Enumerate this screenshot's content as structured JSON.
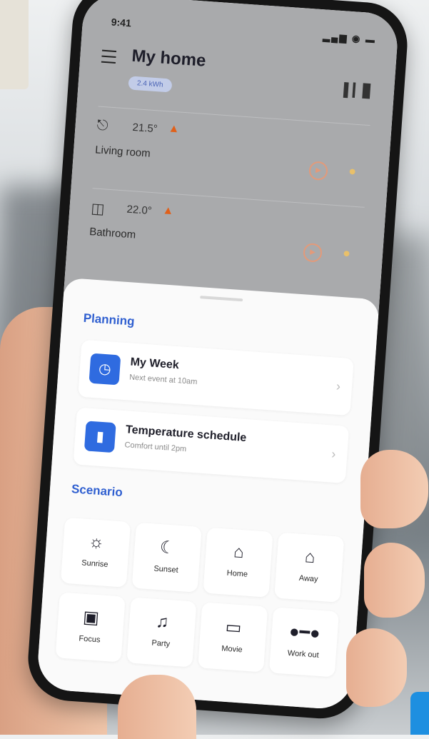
{
  "status_bar": {
    "time": "9:41",
    "indicators": "▂▄▆ ◉ ▬"
  },
  "header": {
    "title": "My home",
    "badge": "2.4 kWh"
  },
  "rooms": [
    {
      "name": "Living room",
      "temperature": "21.5°",
      "icon": "sofa-icon"
    },
    {
      "name": "Bathroom",
      "temperature": "22.0°",
      "icon": "bathtub-icon"
    }
  ],
  "planning": {
    "title": "Planning",
    "items": [
      {
        "title": "My Week",
        "subtitle": "Next event at 10am",
        "icon": "clock-icon"
      },
      {
        "title": "Temperature schedule",
        "subtitle": "Comfort until 2pm",
        "icon": "thermometer-icon"
      }
    ]
  },
  "scenario": {
    "title": "Scenario",
    "items": [
      {
        "label": "Sunrise",
        "icon": "sun-icon"
      },
      {
        "label": "Sunset",
        "icon": "moon-icon"
      },
      {
        "label": "Home",
        "icon": "home-arrive-icon"
      },
      {
        "label": "Away",
        "icon": "home-leave-icon"
      },
      {
        "label": "Focus",
        "icon": "briefcase-icon"
      },
      {
        "label": "Party",
        "icon": "party-icon"
      },
      {
        "label": "Movie",
        "icon": "monitor-icon"
      },
      {
        "label": "Work out",
        "icon": "dumbbell-icon"
      }
    ]
  },
  "colors": {
    "accent": "#2f6be0",
    "section_title": "#2f5fd0",
    "flame": "#e0601a"
  }
}
